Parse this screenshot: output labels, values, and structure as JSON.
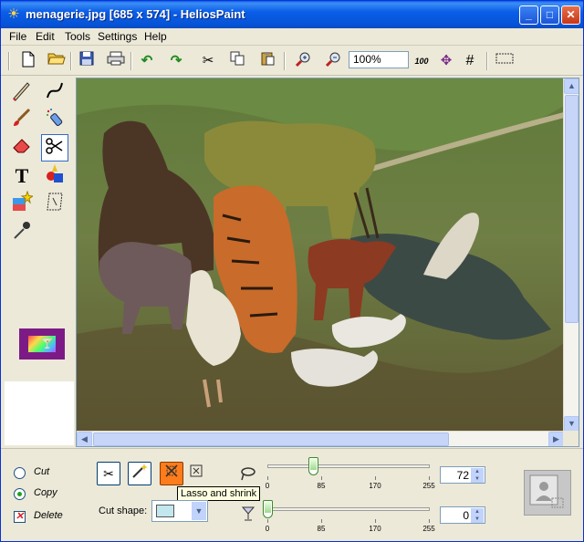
{
  "window": {
    "title": "menagerie.jpg [685 x 574] - HeliosPaint",
    "minimize": "_",
    "maximize": "□",
    "close": "✕"
  },
  "menu": [
    "File",
    "Edit",
    "Tools",
    "Settings",
    "Help"
  ],
  "toolbar": {
    "zoom_value": "100%",
    "zoom_100_label": "100",
    "icons": [
      "new-file-icon",
      "open-folder-icon",
      "save-icon",
      "print-icon",
      "undo-icon",
      "redo-icon",
      "cut-icon",
      "copy-icon",
      "paste-icon",
      "zoom-in-icon",
      "zoom-out-icon",
      "zoom-100-icon",
      "fit-icon",
      "grid-icon",
      "selection-rect-icon"
    ]
  },
  "palette": {
    "text_tool_glyph": "T",
    "tools": [
      "pencil-icon",
      "curve-icon",
      "brush-icon",
      "spray-icon",
      "eraser-icon",
      "lasso-cut-icon",
      "text-icon",
      "shapes-icon",
      "magic-fill-icon",
      "transform-icon",
      "color-picker-icon"
    ]
  },
  "bottom": {
    "options": [
      {
        "label": "Cut",
        "selected": false
      },
      {
        "label": "Copy",
        "selected": true
      },
      {
        "label": "Delete",
        "checked": true
      }
    ],
    "tooltip": "Lasso and shrink",
    "cut_shape_label": "Cut shape:",
    "slider1": {
      "value": "72",
      "ticks": [
        "0",
        "85",
        "170",
        "255"
      ],
      "level": 72,
      "max": 255
    },
    "slider2": {
      "value": "0",
      "ticks": [
        "0",
        "85",
        "170",
        "255"
      ],
      "level": 0,
      "max": 255
    }
  },
  "colors": {
    "accent": "#0a5ee8",
    "palette_swatch": "#7d1b86",
    "active_mode": "#ff7c1a"
  }
}
